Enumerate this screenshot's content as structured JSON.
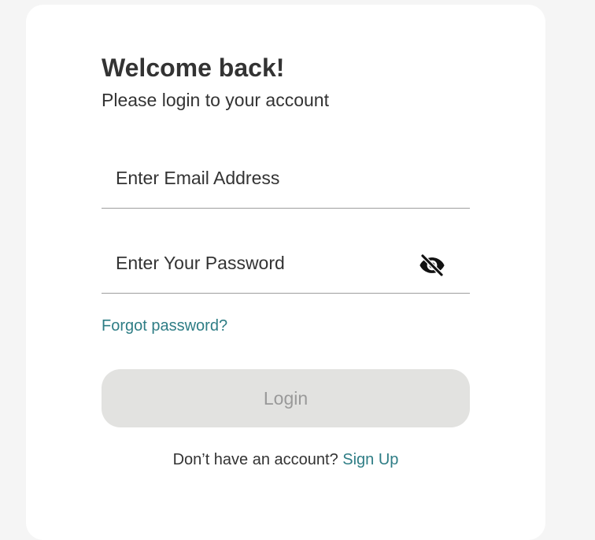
{
  "header": {
    "title": "Welcome back!",
    "subtitle": "Please login to your account"
  },
  "form": {
    "email": {
      "placeholder": "Enter Email Address",
      "value": ""
    },
    "password": {
      "placeholder": "Enter Your Password",
      "value": "",
      "toggle_icon": "eye-off-icon"
    },
    "forgot_label": "Forgot password?",
    "login_label": "Login"
  },
  "footer": {
    "prompt": "Don’t have an account?",
    "signup_label": "Sign Up"
  },
  "colors": {
    "page_background": "#f5f5f5",
    "card_background": "#ffffff",
    "text": "#333333",
    "link": "#2e7d85",
    "button_disabled_bg": "#e2e2e0",
    "button_disabled_text": "#999999",
    "field_border": "#9e9e9e"
  }
}
